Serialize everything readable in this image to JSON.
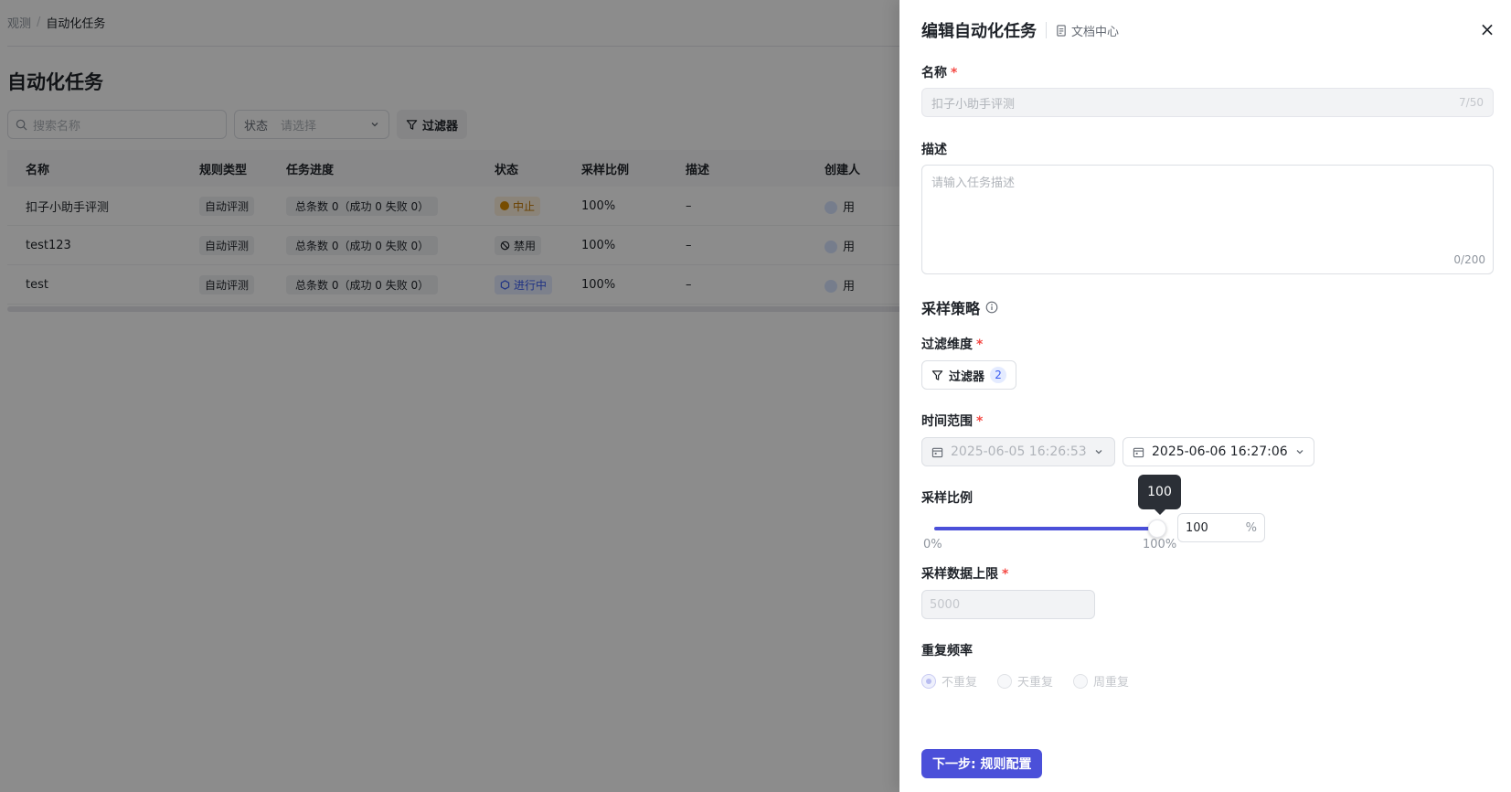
{
  "breadcrumb": {
    "parent": "观测",
    "separator": "/",
    "current": "自动化任务"
  },
  "page": {
    "title": "自动化任务",
    "search_placeholder": "搜索名称",
    "status_filter": {
      "label": "状态",
      "placeholder": "请选择"
    },
    "filter_label": "过滤器"
  },
  "table": {
    "headers": [
      "名称",
      "规则类型",
      "任务进度",
      "状态",
      "采样比例",
      "描述",
      "创建人"
    ],
    "rows": [
      {
        "name": "扣子小助手评测",
        "rule_type": "自动评测",
        "progress": "总条数 0（成功 0  失败 0）",
        "status": "中止",
        "ratio": "100%",
        "desc": "–",
        "creator": "用"
      },
      {
        "name": "test123",
        "rule_type": "自动评测",
        "progress": "总条数 0（成功 0  失败 0）",
        "status": "禁用",
        "ratio": "100%",
        "desc": "–",
        "creator": "用"
      },
      {
        "name": "test",
        "rule_type": "自动评测",
        "progress": "总条数 0（成功 0  失败 0）",
        "status": "进行中",
        "ratio": "100%",
        "desc": "–",
        "creator": "用"
      }
    ]
  },
  "drawer": {
    "title": "编辑自动化任务",
    "doc_link": "文档中心",
    "close_icon": "×",
    "name": {
      "label": "名称",
      "required": "*",
      "value": "扣子小助手评测",
      "counter": "7/50"
    },
    "description": {
      "label": "描述",
      "placeholder": "请输入任务描述",
      "counter": "0/200"
    },
    "strategy_title": "采样策略",
    "filter_dimension": {
      "label": "过滤维度",
      "required": "*",
      "button": "过滤器",
      "count": "2"
    },
    "time_range": {
      "label": "时间范围",
      "required": "*",
      "start": "2025-06-05 16:26:53",
      "end": "2025-06-06 16:27:06"
    },
    "sample_ratio": {
      "label": "采样比例",
      "value": 100,
      "tooltip": "100",
      "min_label": "0%",
      "max_label": "100%",
      "input_value": "100",
      "unit": "%"
    },
    "sample_limit": {
      "label": "采样数据上限",
      "required": "*",
      "placeholder": "5000"
    },
    "repeat": {
      "label": "重复频率",
      "options": [
        "不重复",
        "天重复",
        "周重复"
      ],
      "selected": 0
    },
    "next_button": "下一步: 规则配置"
  }
}
